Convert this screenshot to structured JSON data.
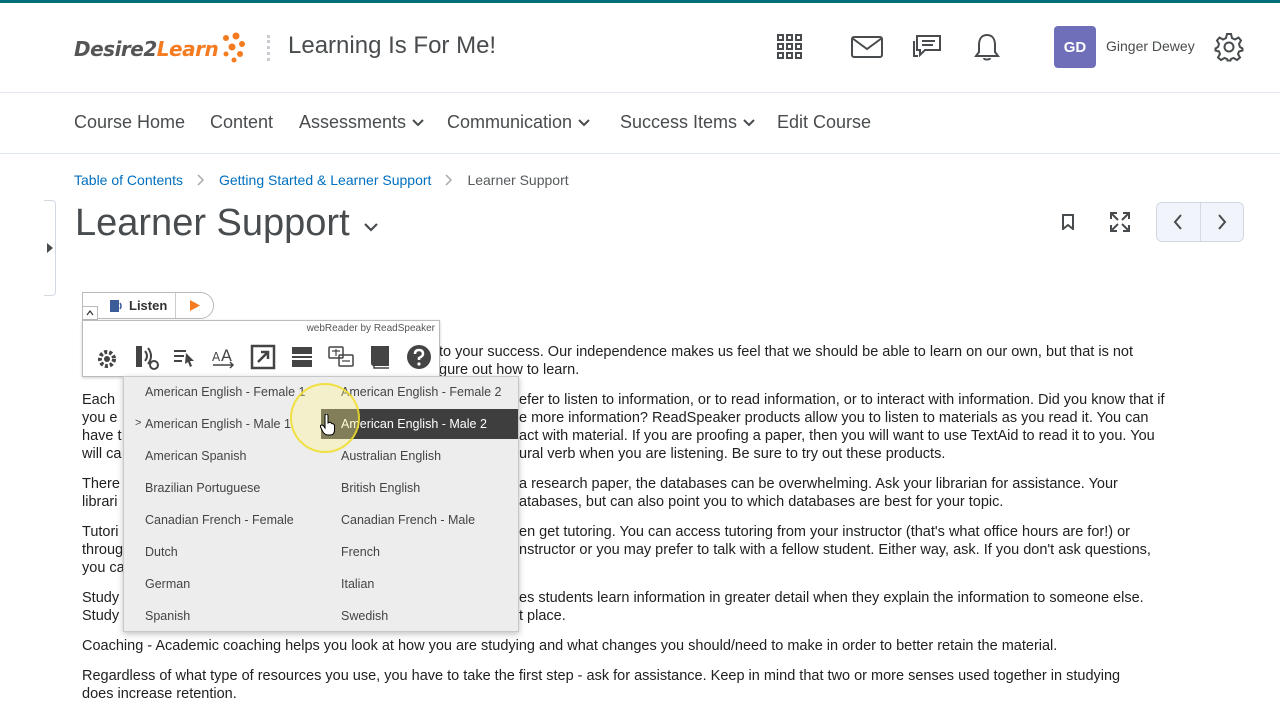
{
  "header": {
    "logo_main": "Desire2",
    "logo_accent": "Learn",
    "site_title": "Learning Is For Me!",
    "icons": [
      "apps-grid-icon",
      "mail-icon",
      "chat-icon",
      "bell-icon",
      "gear-icon"
    ],
    "avatar_initials": "GD",
    "user_name": "Ginger Dewey",
    "avatar_color": "#6e6fb8"
  },
  "nav": {
    "items": [
      {
        "label": "Course Home"
      },
      {
        "label": "Content"
      },
      {
        "label": "Assessments"
      },
      {
        "label": "Communication"
      },
      {
        "label": "Success Items"
      },
      {
        "label": "Edit Course"
      }
    ]
  },
  "breadcrumb": [
    "Table of Contents",
    "Getting Started & Learner Support",
    "Learner Support"
  ],
  "page_title": "Learner Support",
  "readspeaker": {
    "listen_label": "Listen",
    "brand": "webReader by ReadSpeaker"
  },
  "voices": {
    "left": [
      "American English - Female 1",
      "American English - Male 1",
      "American Spanish",
      "Brazilian Portuguese",
      "Canadian French - Female",
      "Dutch",
      "German",
      "Spanish"
    ],
    "right": [
      "American English - Female 2",
      "American English - Male 2",
      "Australian English",
      "British English",
      "Canadian French - Male",
      "French",
      "Italian",
      "Swedish"
    ],
    "current_marker": ">",
    "selected": "American English - Male 2"
  },
  "content": {
    "p1a": "to your success.  Our independence makes us feel that we should be able to learn on our own, but that is not",
    "p1b": "gure out how to learn.",
    "p2a": "Each",
    "p2a_r": "efer to listen to information, or to read information, or to interact with information.  Did you know that if",
    "p2b": "you e",
    "p2b_r": "e more information?  ReadSpeaker products allow you to listen to materials as you read it.  You can",
    "p2c": "have t",
    "p2c_r": "act with material.  If you are proofing a paper, then you will want to use TextAid to read it to you.  You",
    "p2d": "will ca",
    "p2d_r": "ural verb when you are listening.  Be sure to try out these products.",
    "p3a": "There",
    "p3a_r": "a research paper, the databases can be overwhelming.  Ask your librarian for assistance.  Your",
    "p3b": "librari",
    "p3b_r": "atabases, but can also point you to which databases are best for your topic.",
    "p4a": "Tutori",
    "p4a_r": "en get tutoring.  You can access tutoring from your instructor (that's what office hours are for!) or",
    "p4b": "throug",
    "p4b_r": "nstructor or you may prefer to talk with a fellow student.  Either way, ask.  If you don't ask questions,",
    "p4c": "you ca",
    "p5a": "Study",
    "p5a_r": "es students learn information in greater detail when they explain the information to someone else.",
    "p5b": "Study",
    "p5b_r": "t place.",
    "p6": "Coaching - Academic coaching helps you look at how you are studying and what changes you should/need to make in order to better retain the material.",
    "p7a": "Regardless of what type of resources you use, you have to take the first step - ask for assistance.  Keep in mind that two or more senses used together in studying",
    "p7b": "does increase retention."
  }
}
